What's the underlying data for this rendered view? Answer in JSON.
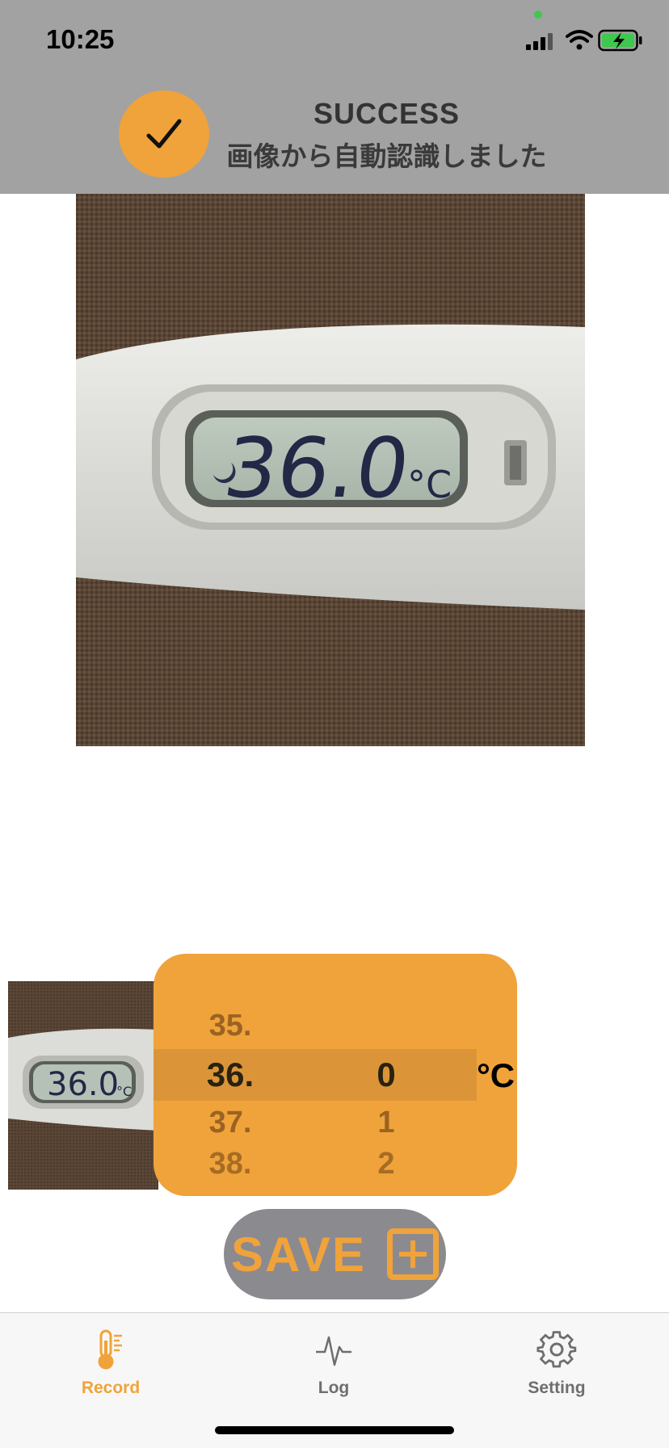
{
  "status_bar": {
    "time": "10:25"
  },
  "banner": {
    "title": "SUCCESS",
    "subtitle": "画像から自動認識しました"
  },
  "thermometer_reading": "36.0",
  "thermometer_unit": "°C",
  "picker": {
    "integer_options": [
      "35.",
      "36.",
      "37.",
      "38."
    ],
    "decimal_options": [
      "0",
      "1",
      "2"
    ],
    "selected_integer": "36.",
    "selected_decimal": "0",
    "unit": "°C"
  },
  "save_label": "SAVE",
  "tabs": [
    {
      "label": "Record",
      "icon": "thermometer-icon",
      "active": true
    },
    {
      "label": "Log",
      "icon": "heartbeat-icon",
      "active": false
    },
    {
      "label": "Setting",
      "icon": "gear-icon",
      "active": false
    }
  ],
  "colors": {
    "accent": "#f0a33a",
    "banner": "#a2a2a2",
    "save_button": "#8b8a8f"
  }
}
